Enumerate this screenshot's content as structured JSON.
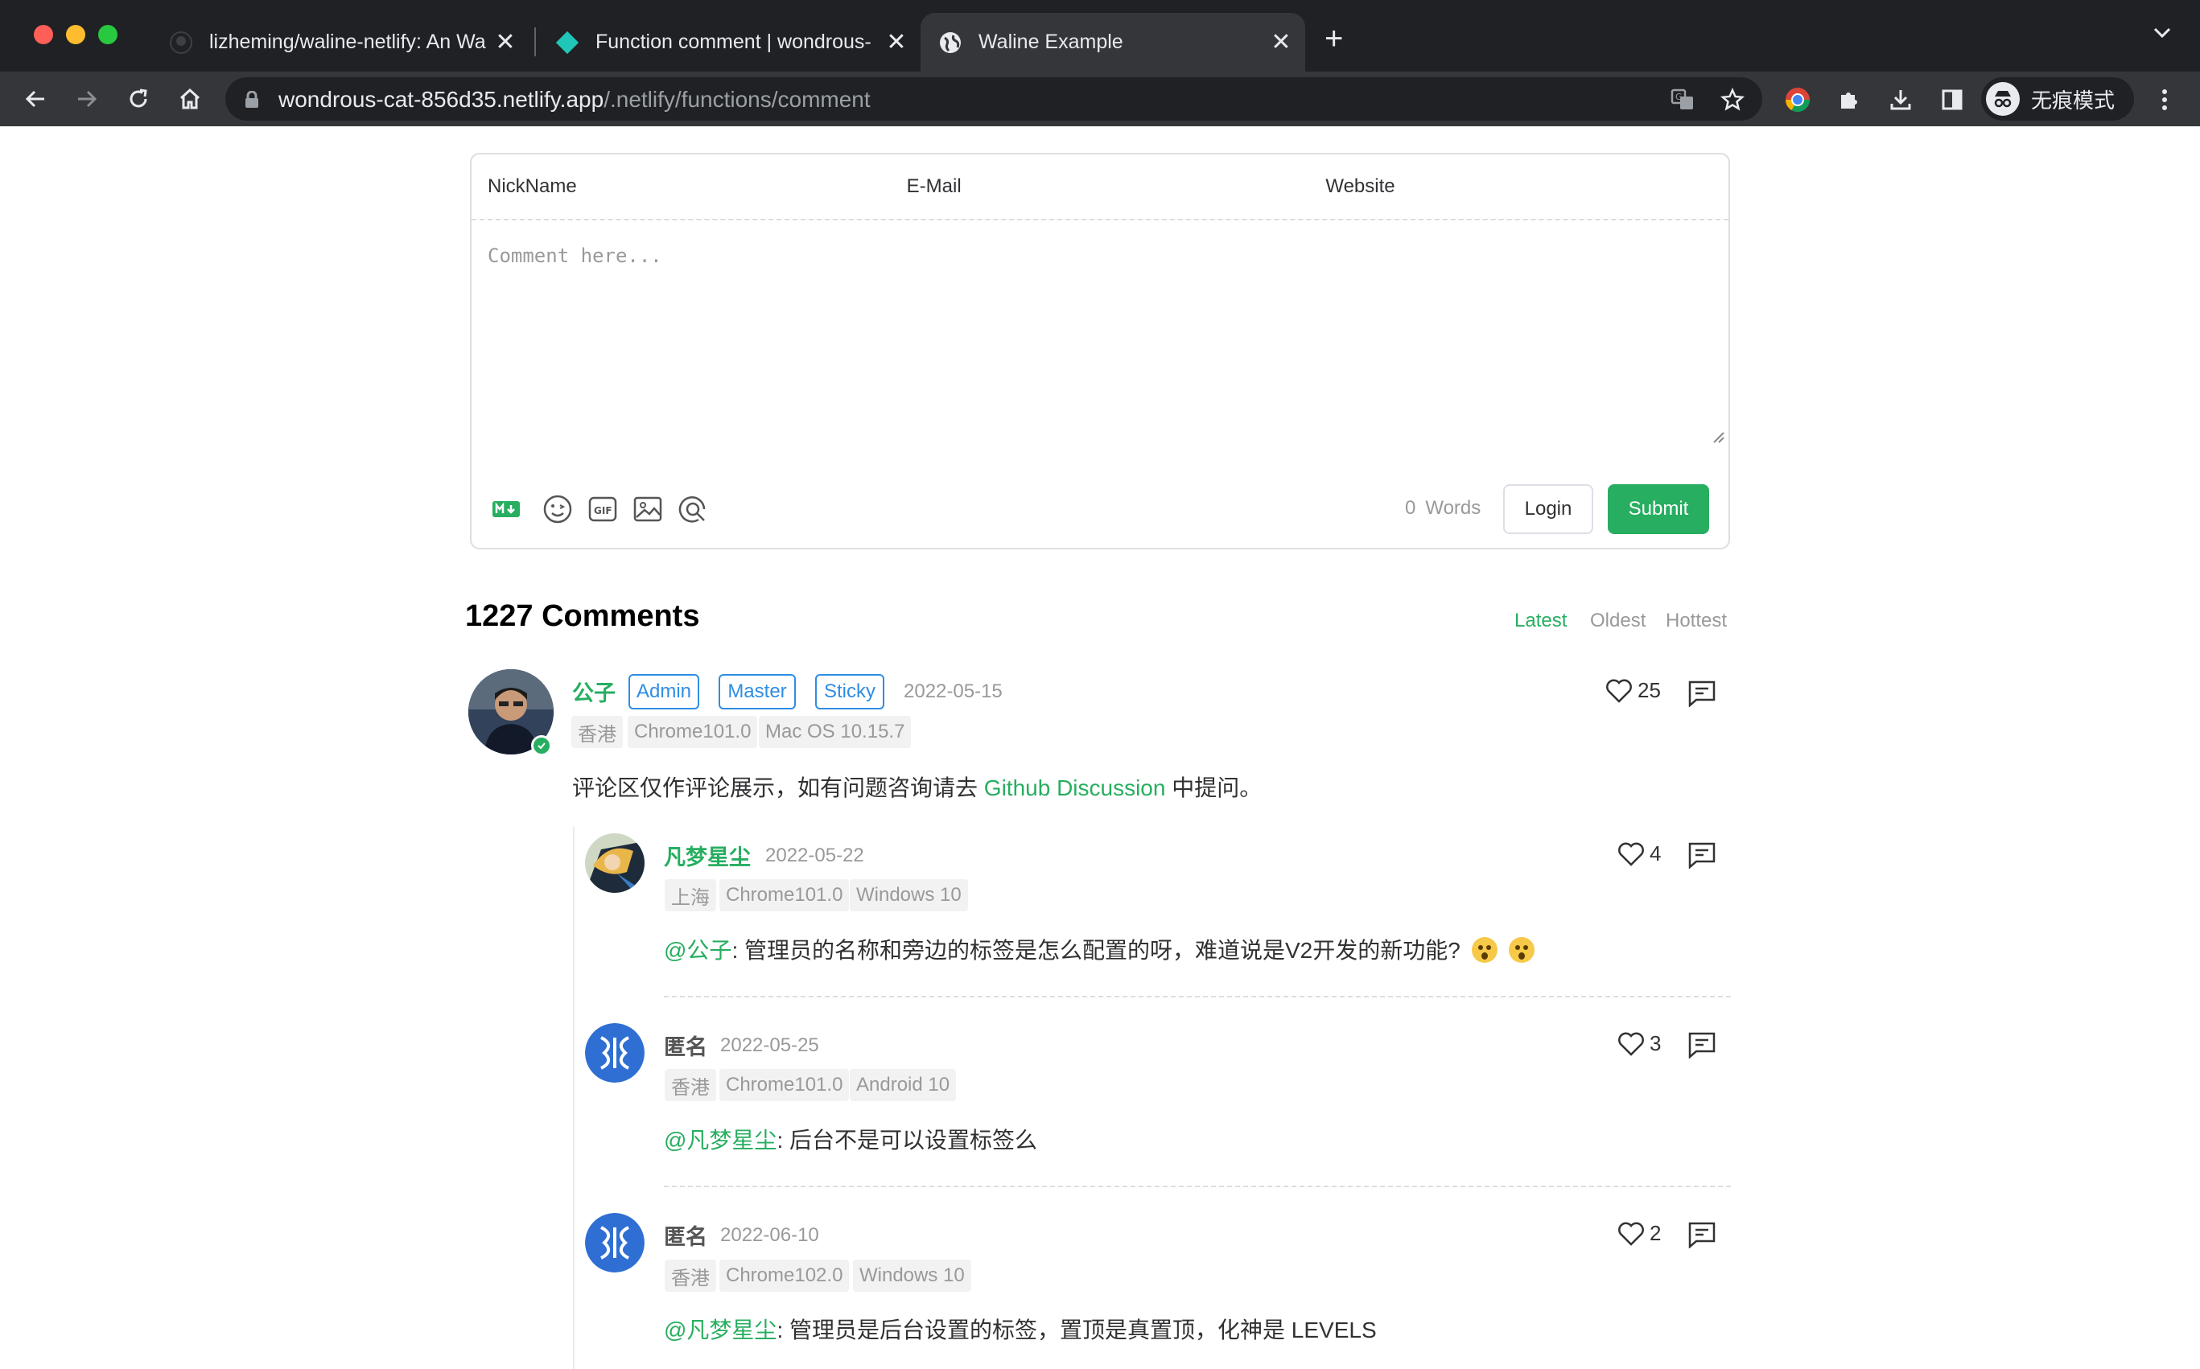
{
  "browser": {
    "tabs": [
      {
        "title": "lizheming/waline-netlify: An Wa",
        "icon": "github-icon"
      },
      {
        "title": "Function comment | wondrous-",
        "icon": "netlify-icon"
      },
      {
        "title": "Waline Example",
        "icon": "globe-icon"
      }
    ],
    "address": {
      "host": "wondrous-cat-856d35.netlify.app",
      "path": "/.netlify/functions/comment"
    },
    "profile_label": "无痕模式"
  },
  "editor": {
    "nick_placeholder": "NickName",
    "email_placeholder": "E-Mail",
    "website_placeholder": "Website",
    "comment_placeholder": "Comment here...",
    "word_count": "0",
    "word_label": "Words",
    "login_label": "Login",
    "submit_label": "Submit"
  },
  "comments_header": {
    "count_title": "1227 Comments",
    "sort": [
      "Latest",
      "Oldest",
      "Hottest"
    ],
    "active_sort": "Latest"
  },
  "comments": [
    {
      "author": "公子",
      "badges": [
        "Admin",
        "Master",
        "Sticky"
      ],
      "date": "2022-05-15",
      "meta": [
        "香港",
        "Chrome101.0",
        "Mac OS 10.15.7"
      ],
      "likes": "25",
      "content_pre": "评论区仅作评论展示，如有问题咨询请去 ",
      "content_link": "Github Discussion",
      "content_post": " 中提问。",
      "replies": [
        {
          "author": "凡梦星尘",
          "date": "2022-05-22",
          "meta": [
            "上海",
            "Chrome101.0",
            "Windows 10"
          ],
          "likes": "4",
          "mention": "@公子",
          "content": ": 管理员的名称和旁边的标签是怎么配置的呀，难道说是V2开发的新功能?"
        },
        {
          "author": "匿名",
          "date": "2022-05-25",
          "meta": [
            "香港",
            "Chrome101.0",
            "Android 10"
          ],
          "likes": "3",
          "mention": "@凡梦星尘",
          "content": ": 后台不是可以设置标签么"
        },
        {
          "author": "匿名",
          "date": "2022-06-10",
          "meta": [
            "香港",
            "Chrome102.0",
            "Windows 10"
          ],
          "likes": "2",
          "mention": "@凡梦星尘",
          "content": ": 管理员是后台设置的标签，置顶是真置顶，化神是 LEVELS"
        }
      ]
    }
  ],
  "colors": {
    "accent": "#27ae60",
    "badge": "#2f8de4",
    "chrome_bg": "#202124",
    "toolbar_bg": "#35363a"
  }
}
